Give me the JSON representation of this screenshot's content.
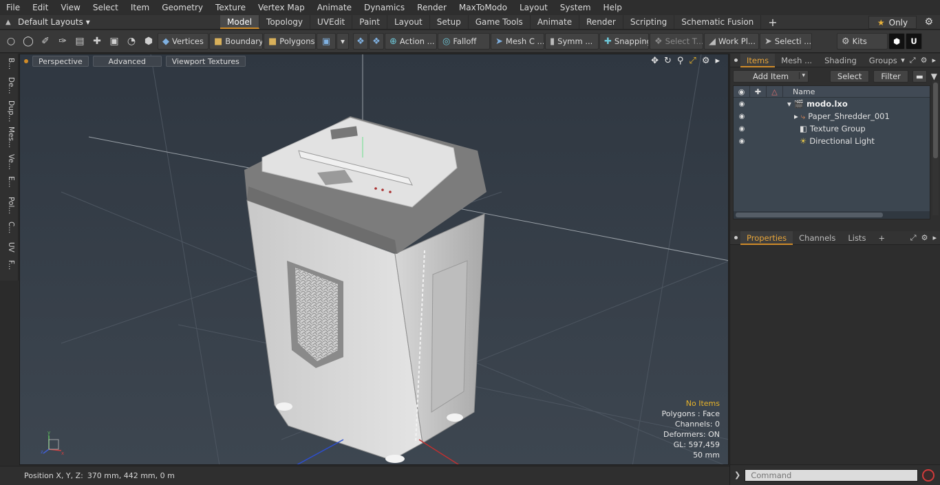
{
  "menubar": {
    "items": [
      "File",
      "Edit",
      "View",
      "Select",
      "Item",
      "Geometry",
      "Texture",
      "Vertex Map",
      "Animate",
      "Dynamics",
      "Render",
      "MaxToModo",
      "Layout",
      "System",
      "Help"
    ]
  },
  "layoutbar": {
    "layouts_label": "Default Layouts",
    "tabs": [
      {
        "label": "Model",
        "active": true
      },
      {
        "label": "Topology"
      },
      {
        "label": "UVEdit"
      },
      {
        "label": "Paint"
      },
      {
        "label": "Layout"
      },
      {
        "label": "Setup"
      },
      {
        "label": "Game Tools"
      },
      {
        "label": "Animate"
      },
      {
        "label": "Render"
      },
      {
        "label": "Scripting"
      },
      {
        "label": "Schematic Fusion"
      }
    ],
    "only_label": "Only"
  },
  "toolbar": {
    "vertices": "Vertices",
    "boundary": "Boundary",
    "polygons": "Polygons",
    "action": "Action ...",
    "falloff": "Falloff",
    "mesh": "Mesh C ...",
    "symm": "Symm ...",
    "snapping": "Snapping",
    "select_t": "Select T...",
    "work_plane": "Work Pl...",
    "selecti": "Selecti ...",
    "kits": "Kits"
  },
  "left_tabs": [
    "B...",
    "De...",
    "Dup...",
    "Mes...",
    "Ve...",
    "E...",
    "Pol...",
    "C...",
    "UV",
    "F..."
  ],
  "viewport": {
    "perspective": "Perspective",
    "advanced": "Advanced",
    "textures": "Viewport Textures",
    "info": {
      "no_items": "No Items",
      "polygons": "Polygons : Face",
      "channels": "Channels: 0",
      "deformers": "Deformers: ON",
      "gl": "GL: 597,459",
      "scale": "50 mm"
    }
  },
  "status": {
    "position_label": "Position X, Y, Z:",
    "position_value": "370 mm, 442 mm, 0 m"
  },
  "items_panel": {
    "tabs": [
      {
        "label": "Items",
        "active": true
      },
      {
        "label": "Mesh ..."
      },
      {
        "label": "Shading"
      },
      {
        "label": "Groups"
      }
    ],
    "add_item": "Add Item",
    "select": "Select",
    "filter": "Filter",
    "name_header": "Name",
    "rows": [
      {
        "label": "modo.lxo"
      },
      {
        "label": "Paper_Shredder_001"
      },
      {
        "label": "Texture Group"
      },
      {
        "label": "Directional Light"
      }
    ]
  },
  "props_panel": {
    "tabs": [
      {
        "label": "Properties",
        "active": true
      },
      {
        "label": "Channels"
      },
      {
        "label": "Lists"
      }
    ],
    "add": "+"
  },
  "command": {
    "placeholder": "Command"
  }
}
